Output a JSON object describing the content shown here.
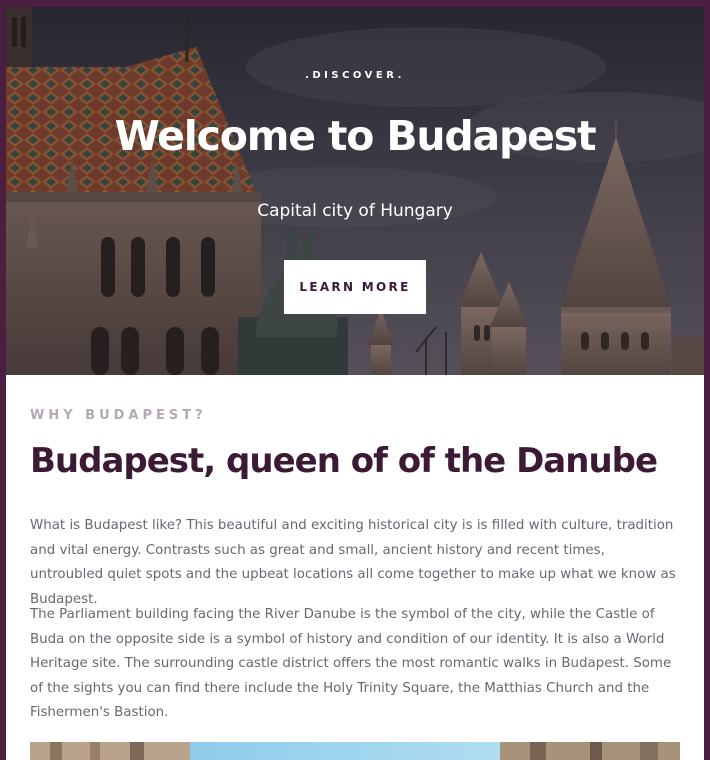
{
  "hero": {
    "eyebrow": ".DISCOVER.",
    "title": "Welcome to Budapest",
    "subtitle": "Capital city of Hungary",
    "cta_label": "LEARN MORE"
  },
  "intro": {
    "kicker": "WHY BUDAPEST?",
    "title": "Budapest, queen of of the Danube",
    "paragraphs": [
      "What is Budapest like? This beautiful and exciting historical city is is filled with culture, tradition and vital energy. Contrasts such as great and small, ancient history and recent times, untroubled quiet spots and the upbeat locations all come together to make up what we know as Budapest.",
      "The Parliament building facing the River Danube is the symbol of the city, while the Castle of Buda on the opposite side is a symbol of history and condition of our identity. It is also a World Heritage site. The surrounding castle district offers the most romantic walks in Budapest. Some of the sights you can find there include the Holy Trinity Square, the Matthias Church and the Fishermen's Bastion."
    ]
  },
  "colors": {
    "page_border": "#4a1f3f",
    "heading": "#3c1a35",
    "kicker": "#b3a9b2",
    "body_text": "#6d6570",
    "button_bg": "#ffffff"
  }
}
